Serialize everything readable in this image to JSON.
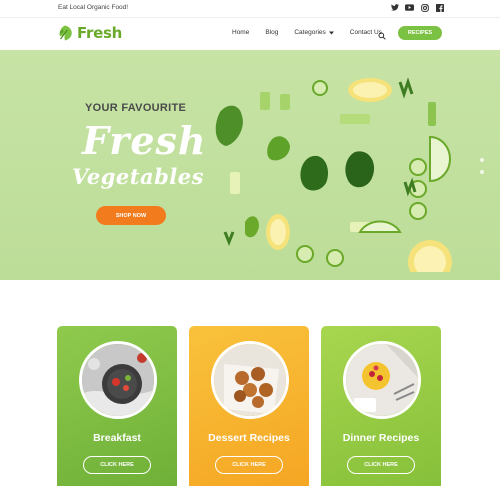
{
  "topbar": {
    "tagline": "Eat Local Organic Food!",
    "social_icons": [
      "twitter-icon",
      "youtube-icon",
      "instagram-icon",
      "facebook-icon"
    ]
  },
  "header": {
    "logo_text": "Fresh",
    "nav": [
      {
        "label": "Home"
      },
      {
        "label": "Blog"
      },
      {
        "label": "Categories",
        "has_dropdown": true
      },
      {
        "label": "Contact Us"
      }
    ],
    "search_icon": "search-icon",
    "recipes_label": "RECIPES"
  },
  "hero": {
    "subtitle": "YOUR FAVOURITE",
    "title_line1": "Fresh",
    "title_line2": "Vegetables",
    "button_label": "SHOP NOW"
  },
  "cards": [
    {
      "title": "Breakfast",
      "button_label": "CLICK HERE"
    },
    {
      "title": "Dessert Recipes",
      "button_label": "CLICK HERE"
    },
    {
      "title": "Dinner Recipes",
      "button_label": "CLICK HERE"
    }
  ],
  "colors": {
    "brand_green": "#7cc242",
    "orange": "#f27c1d",
    "hero_bg": "#c7e3a5",
    "card_yellow": "#f7b733"
  }
}
